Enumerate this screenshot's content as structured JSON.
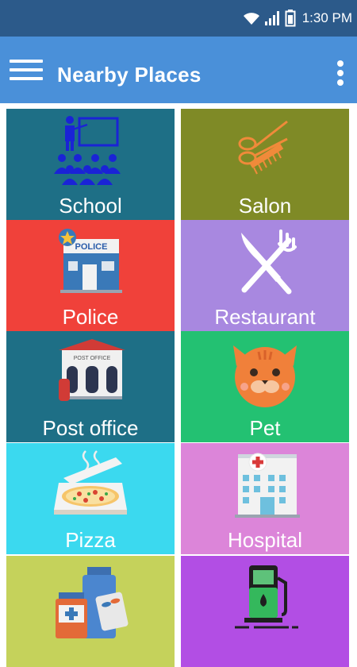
{
  "status_bar": {
    "time": "1:30 PM"
  },
  "app_bar": {
    "title": "Nearby Places"
  },
  "tiles": [
    {
      "label": "School",
      "color": "#1e6f86",
      "icon": "school-icon"
    },
    {
      "label": "Salon",
      "color": "#7f8a26",
      "icon": "scissors-comb-icon"
    },
    {
      "label": "Police",
      "color": "#f0413a",
      "icon": "police-station-icon"
    },
    {
      "label": "Restaurant",
      "color": "#a888e0",
      "icon": "knife-fork-icon"
    },
    {
      "label": "Post office",
      "color": "#1e6f86",
      "icon": "post-office-icon"
    },
    {
      "label": "Pet",
      "color": "#23c172",
      "icon": "cat-icon"
    },
    {
      "label": "Pizza",
      "color": "#3bd9ef",
      "icon": "pizza-box-icon"
    },
    {
      "label": "Hospital",
      "color": "#dc85d9",
      "icon": "hospital-icon"
    },
    {
      "label": "",
      "color": "#c5d25b",
      "icon": "pharmacy-icon"
    },
    {
      "label": "",
      "color": "#b24ee4",
      "icon": "fuel-pump-icon"
    }
  ]
}
